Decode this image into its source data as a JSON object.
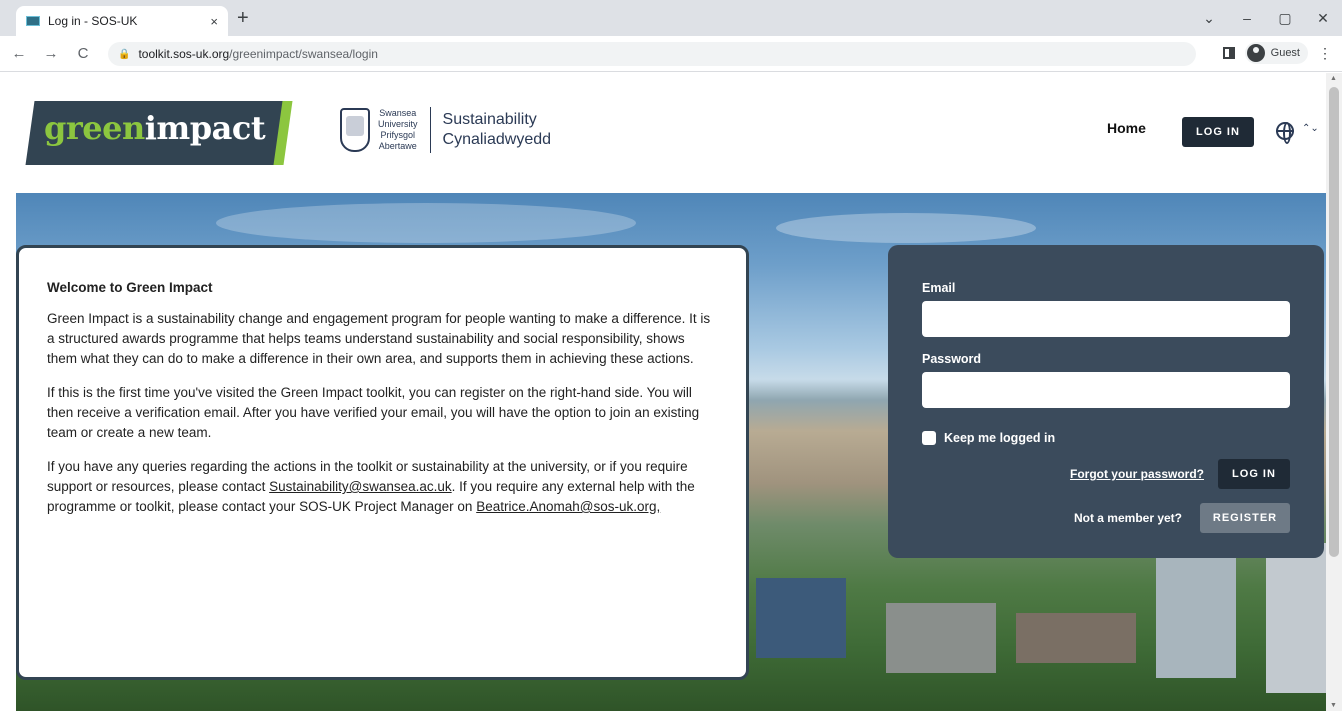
{
  "browser": {
    "tab_title": "Log in - SOS-UK",
    "tab_close": "×",
    "new_tab": "+",
    "url_host": "toolkit.sos-uk.org",
    "url_path": "/greenimpact/swansea/login",
    "profile_label": "Guest",
    "window_controls": [
      "⌄",
      "–",
      "▢",
      "✕"
    ]
  },
  "header": {
    "logo_green": "green",
    "logo_white": "impact",
    "uni_name_en_1": "Swansea",
    "uni_name_en_2": "University",
    "uni_name_cy_1": "Prifysgol",
    "uni_name_cy_2": "Abertawe",
    "dept_en": "Sustainability",
    "dept_cy": "Cynaliadwyedd",
    "nav_home": "Home",
    "nav_login": "LOG IN",
    "lang_toggle": "⌃⌄"
  },
  "welcome": {
    "heading": "Welcome to Green Impact",
    "para1": "Green Impact is a sustainability change and engagement program for people wanting to make a difference. It is a structured awards programme that helps teams understand sustainability and social responsibility, shows them what they can do to make a difference in their own area, and supports them in achieving these actions.",
    "para2": "If this is the first time you've visited the Green Impact toolkit, you can register on the right-hand side. You will then receive a verification email. After you have verified your email, you will have the option to join an existing team or create a new team.",
    "para3_a": "If you have any queries regarding the actions in the toolkit or sustainability at the university, or if you require support or resources, please contact ",
    "para3_link1": "Sustainability@swansea.ac.uk",
    "para3_b": ". If you require any external help with the programme or toolkit, please contact your SOS-UK Project Manager on ",
    "para3_link2": "Beatrice.Anomah@sos-uk.org,"
  },
  "login": {
    "email_label": "Email",
    "email_value": "",
    "password_label": "Password",
    "password_value": "",
    "keep_logged_in": "Keep me logged in",
    "forgot_password": "Forgot your password?",
    "login_button": "LOG IN",
    "not_member": "Not a member yet?",
    "register_button": "REGISTER"
  },
  "colors": {
    "brand_dark": "#324452",
    "brand_green": "#8cc63f",
    "login_panel": "#3b4b5c",
    "button_dark": "#1f2a36"
  }
}
